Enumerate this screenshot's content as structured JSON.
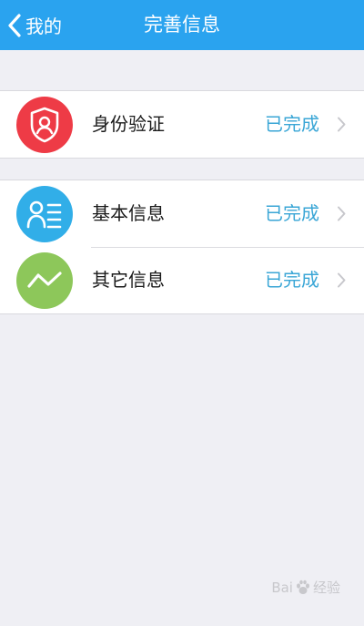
{
  "nav": {
    "back_label": "我的",
    "title": "完善信息"
  },
  "groups": [
    {
      "items": [
        {
          "label": "身份验证",
          "status": "已完成",
          "icon": "shield-user-icon",
          "color": "#ee3b46"
        }
      ]
    },
    {
      "items": [
        {
          "label": "基本信息",
          "status": "已完成",
          "icon": "profile-card-icon",
          "color": "#31aee8"
        },
        {
          "label": "其它信息",
          "status": "已完成",
          "icon": "trend-line-icon",
          "color": "#8dc75a"
        }
      ]
    }
  ],
  "colors": {
    "navbar": "#2aa3ef",
    "status": "#3aa6d6",
    "background": "#efeff4"
  },
  "watermark": {
    "left": "Bai",
    "right": "经验"
  }
}
